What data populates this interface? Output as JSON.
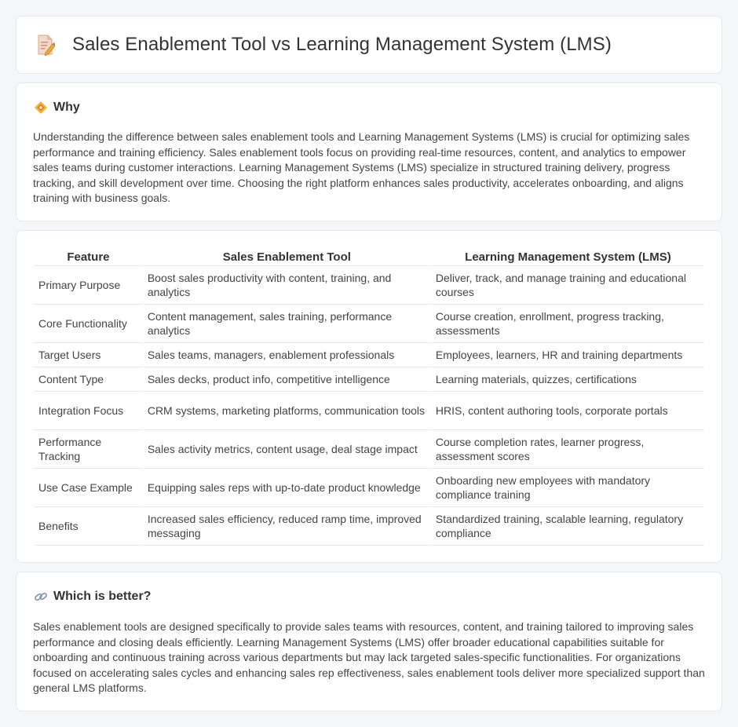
{
  "page": {
    "title": "Sales Enablement Tool vs Learning Management System (LMS)",
    "icon": "document-pencil-icon"
  },
  "why": {
    "icon": "diamond-icon",
    "heading": "Why",
    "body": "Understanding the difference between sales enablement tools and Learning Management Systems (LMS) is crucial for optimizing sales performance and training efficiency. Sales enablement tools focus on providing real-time resources, content, and analytics to empower sales teams during customer interactions. Learning Management Systems (LMS) specialize in structured training delivery, progress tracking, and skill development over time. Choosing the right platform enhances sales productivity, accelerates onboarding, and aligns training with business goals."
  },
  "comparison": {
    "headers": [
      "Feature",
      "Sales Enablement Tool",
      "Learning Management System (LMS)"
    ],
    "rows": [
      [
        "Primary Purpose",
        "Boost sales productivity with content, training, and analytics",
        "Deliver, track, and manage training and educational courses"
      ],
      [
        "Core Functionality",
        "Content management, sales training, performance analytics",
        "Course creation, enrollment, progress tracking, assessments"
      ],
      [
        "Target Users",
        "Sales teams, managers, enablement professionals",
        "Employees, learners, HR and training departments"
      ],
      [
        "Content Type",
        "Sales decks, product info, competitive intelligence",
        "Learning materials, quizzes, certifications"
      ],
      [
        "Integration Focus",
        "CRM systems, marketing platforms, communication tools",
        "HRIS, content authoring tools, corporate portals"
      ],
      [
        "Performance Tracking",
        "Sales activity metrics, content usage, deal stage impact",
        "Course completion rates, learner progress, assessment scores"
      ],
      [
        "Use Case Example",
        "Equipping sales reps with up-to-date product knowledge",
        "Onboarding new employees with mandatory compliance training"
      ],
      [
        "Benefits",
        "Increased sales efficiency, reduced ramp time, improved messaging",
        "Standardized training, scalable learning, regulatory compliance"
      ]
    ]
  },
  "better": {
    "icon": "link-icon",
    "heading": "Which is better?",
    "body": "Sales enablement tools are designed specifically to provide sales teams with resources, content, and training tailored to improving sales performance and closing deals efficiently. Learning Management Systems (LMS) offer broader educational capabilities suitable for onboarding and continuous training across various departments but may lack targeted sales-specific functionalities. For organizations focused on accelerating sales cycles and enhancing sales rep effectiveness, sales enablement tools deliver more specialized support than general LMS platforms."
  }
}
